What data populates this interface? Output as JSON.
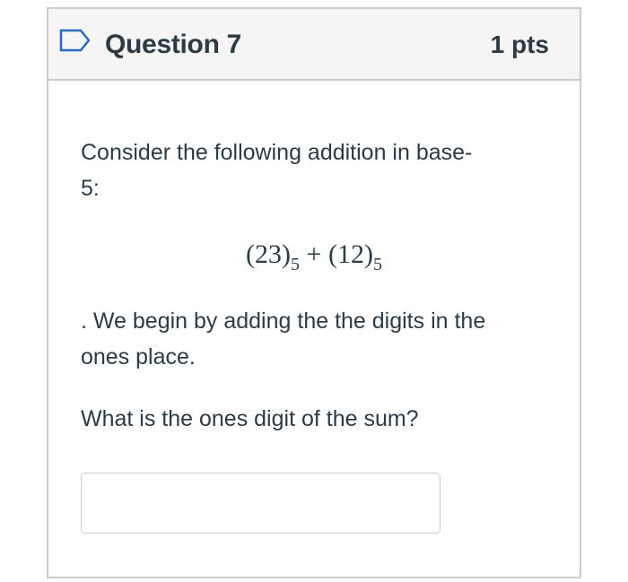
{
  "question": {
    "flag_icon": "flag-outline-icon",
    "title": "Question 7",
    "points": "1 pts",
    "text_line1": "Consider the following addition in base-",
    "text_line2": "5:",
    "formula": {
      "first": "(23)",
      "first_base": "5",
      "operator": "+",
      "second": "(12)",
      "second_base": "5"
    },
    "text_after_line1": ". We begin by adding the the digits in the",
    "text_after_line2": "ones place.",
    "prompt": "What is the ones digit of the sum?",
    "answer": {
      "value": "",
      "placeholder": ""
    }
  },
  "colors": {
    "text": "#2d3b45",
    "header_bg": "#f5f5f5",
    "border": "#c7cdd1",
    "flag": "#2d6ac2"
  }
}
